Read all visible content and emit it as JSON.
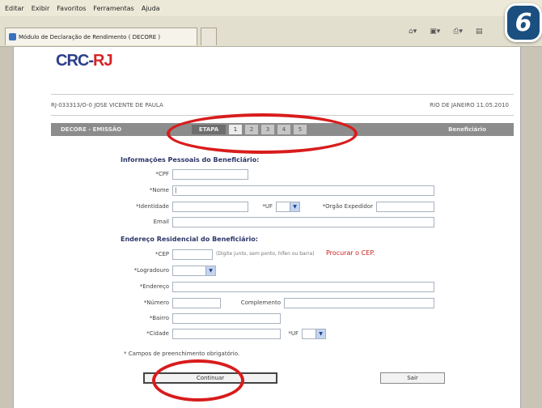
{
  "browser": {
    "menu": [
      "Editar",
      "Exibir",
      "Favoritos",
      "Ferramentas",
      "Ajuda"
    ],
    "tab_title": "Módulo de Declaração de Rendimento ( DECORE )",
    "toolbar_icons": [
      "home-icon",
      "feeds-icon",
      "print-icon",
      "page-icon"
    ]
  },
  "step_badge": "6",
  "page": {
    "logo_crc": "CRC-",
    "logo_rj": "RJ",
    "user": "RJ-033313/O-0 JOSE VICENTE DE PAULA",
    "date": "RIO DE JANEIRO 11.05.2010",
    "bar": {
      "left": "DECORE - EMISSÃO",
      "etapa": "ETAPA",
      "steps": [
        "1",
        "2",
        "3",
        "4",
        "5"
      ],
      "active_step": 1,
      "right": "Beneficiário"
    }
  },
  "form": {
    "personal_title": "Informações Pessoais do Beneficiário:",
    "address_title": "Endereço Residencial do Beneficiário:",
    "labels": {
      "cpf": "*CPF",
      "nome": "*Nome",
      "identidade": "*Identidade",
      "uf": "*UF",
      "orgao": "*Orgão Expedidor",
      "email": "Email",
      "cep": "*CEP",
      "logradouro": "*Logradouro",
      "endereco": "*Endereço",
      "numero": "*Número",
      "complemento": "Complemento",
      "bairro": "*Bairro",
      "cidade": "*Cidade",
      "uf2": "*UF"
    },
    "cep_hint": "(Digite junto, sem ponto, hífen ou barra)",
    "cep_link": "Procurar o CEP.",
    "required_note": "* Campos de preenchimento obrigatório.",
    "continue_label": "Continuar",
    "exit_label": "Sair"
  },
  "accent": {
    "highlight": "#d81c1c",
    "badge": "#1a4f80"
  }
}
